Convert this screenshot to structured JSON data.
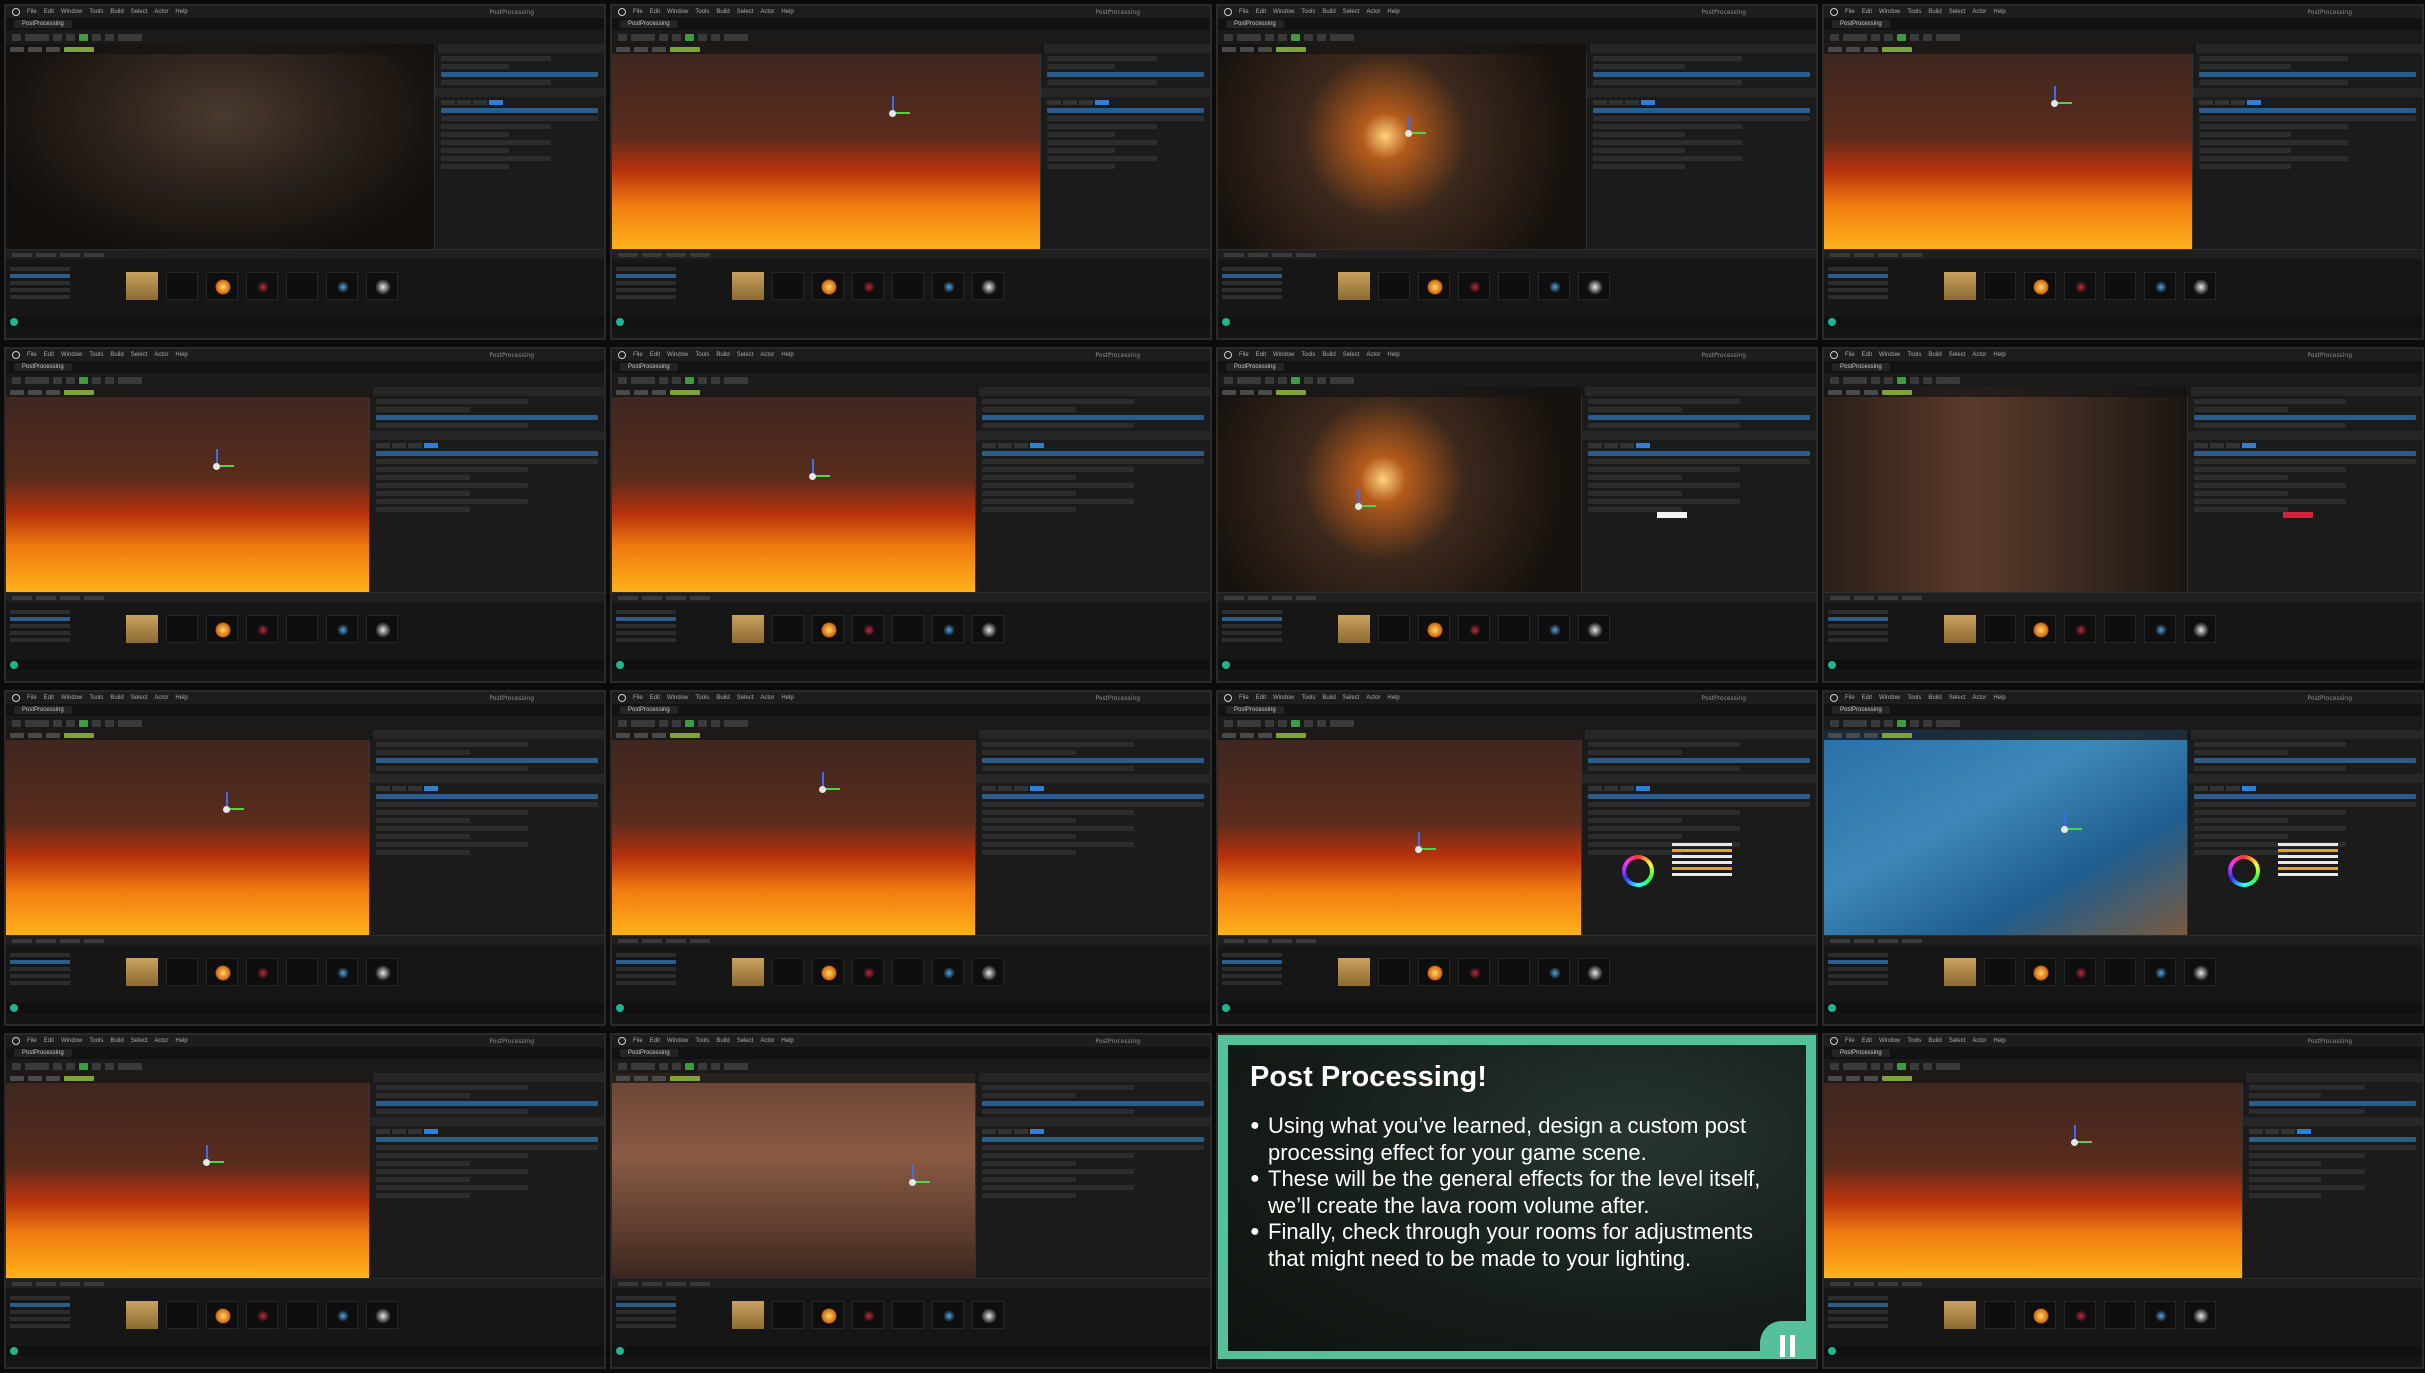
{
  "window": {
    "title": "PostProcessing",
    "project_tab": "PostProcessing",
    "menu": [
      "File",
      "Edit",
      "Window",
      "Tools",
      "Build",
      "Select",
      "Actor",
      "Help"
    ]
  },
  "slide": {
    "title": "Post Processing!",
    "bullets": [
      "Using what you’ve learned, design a custom post processing effect for your game scene.",
      "These will be the general effects for the level itself, we’ll create the lava room volume after.",
      "Finally, check through your rooms for adjustments that might need to be made to your lighting."
    ]
  },
  "tiles": [
    {
      "scene": "cave",
      "panel": "list"
    },
    {
      "scene": "lava",
      "panel": "list"
    },
    {
      "scene": "torch",
      "panel": "details"
    },
    {
      "scene": "lava",
      "panel": "details"
    },
    {
      "scene": "lava",
      "panel": "details-wide"
    },
    {
      "scene": "lava",
      "panel": "details-wide"
    },
    {
      "scene": "torch",
      "panel": "details-white"
    },
    {
      "scene": "wall",
      "panel": "details-red"
    },
    {
      "scene": "lava",
      "panel": "details-wide"
    },
    {
      "scene": "lava",
      "panel": "details-wide"
    },
    {
      "scene": "lava",
      "panel": "details-wheel"
    },
    {
      "scene": "blue",
      "panel": "details-wheel"
    },
    {
      "scene": "lava",
      "panel": "details-wide"
    },
    {
      "scene": "wall2",
      "panel": "details-wide"
    },
    {
      "scene": "slide",
      "panel": "none"
    },
    {
      "scene": "lava",
      "panel": "details-narrow"
    }
  ],
  "colors": {
    "slide_accent": "#55c19b",
    "play_button": "#3f9b3f",
    "selection": "#2c5d8a",
    "gizmo_z": "#3b6df0",
    "gizmo_x": "#47d84a"
  }
}
